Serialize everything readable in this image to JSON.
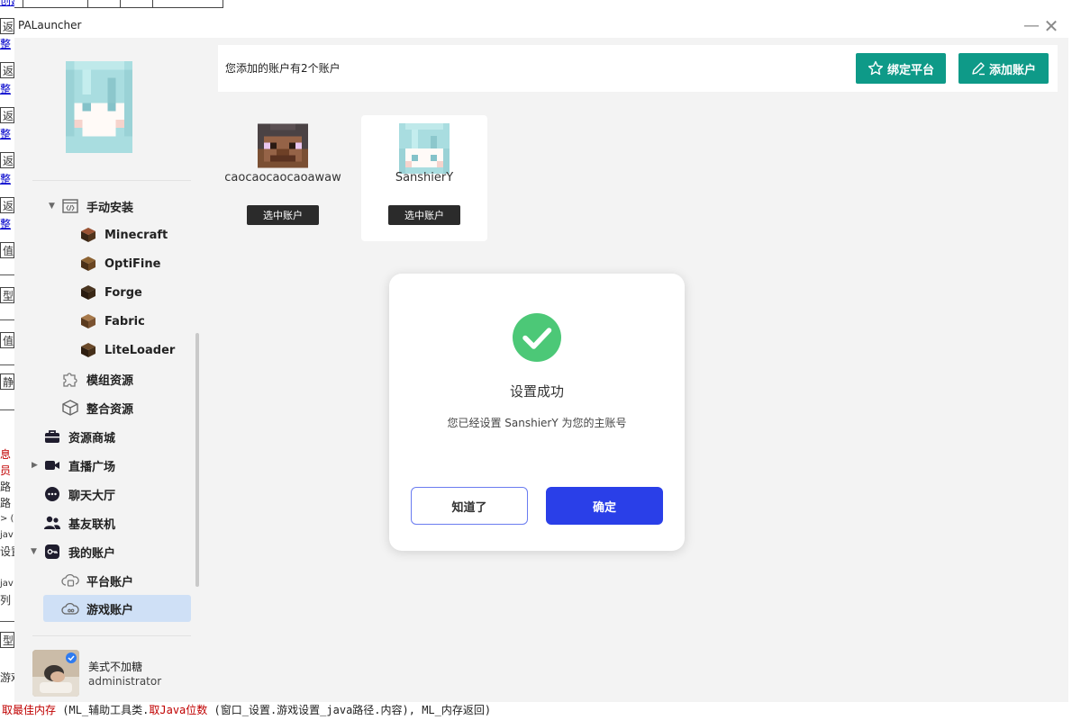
{
  "background": {
    "left_fragments": [
      "创建",
      "返",
      "整",
      "返",
      "整",
      "返",
      "整",
      "返",
      "整",
      "返",
      "整",
      "值",
      "型",
      "值",
      "静态",
      "息",
      "员",
      "路",
      "路",
      "> (",
      "jav",
      "设置",
      "jav",
      "列",
      "型",
      "游戏"
    ],
    "bottom_code": {
      "part1": "取最佳内存",
      "part2": " (ML_辅助工具类.",
      "part3": "取Java位数",
      "part4": " (窗口_设置.游戏设置_java路径.内容), ML_内存返回)"
    }
  },
  "window": {
    "title": "PALauncher",
    "minimize_glyph": "—",
    "close_glyph": "✕"
  },
  "sidebar": {
    "items": [
      {
        "label": "手动安装",
        "icon": "code-window-icon"
      },
      {
        "label": "Minecraft",
        "icon": "grass-block-icon"
      },
      {
        "label": "OptiFine",
        "icon": "grass-block-icon"
      },
      {
        "label": "Forge",
        "icon": "grass-block-icon"
      },
      {
        "label": "Fabric",
        "icon": "grass-block-icon"
      },
      {
        "label": "LiteLoader",
        "icon": "grass-block-icon"
      },
      {
        "label": "模组资源",
        "icon": "puzzle-icon"
      },
      {
        "label": "整合资源",
        "icon": "box-icon"
      },
      {
        "label": "资源商城",
        "icon": "briefcase-icon"
      },
      {
        "label": "直播广场",
        "icon": "video-icon"
      },
      {
        "label": "聊天大厅",
        "icon": "chat-icon"
      },
      {
        "label": "基友联机",
        "icon": "people-icon"
      },
      {
        "label": "我的账户",
        "icon": "key-icon"
      },
      {
        "label": "平台账户",
        "icon": "cloud-lock-icon"
      },
      {
        "label": "游戏账户",
        "icon": "cloud-game-icon"
      }
    ],
    "active_item": "游戏账户",
    "user": {
      "name": "美式不加糖",
      "role": "administrator"
    }
  },
  "main": {
    "account_count_text": "您添加的账户有2个账户",
    "bind_platform_label": "绑定平台",
    "add_account_label": "添加账户",
    "accounts": [
      {
        "name": "caocaocaocaoawaw",
        "select_label": "选中账户",
        "selected": false
      },
      {
        "name": "SanshierY",
        "select_label": "选中账户",
        "selected": true
      }
    ]
  },
  "dialog": {
    "title": "设置成功",
    "message": "您已经设置 SanshierY 为您的主账号",
    "cancel_label": "知道了",
    "ok_label": "确定",
    "icon": "check-circle-icon"
  },
  "colors": {
    "teal": "#0e9a88",
    "primary": "#2a3fe8",
    "success": "#4cc877",
    "active_nav": "#cfe0f6"
  }
}
